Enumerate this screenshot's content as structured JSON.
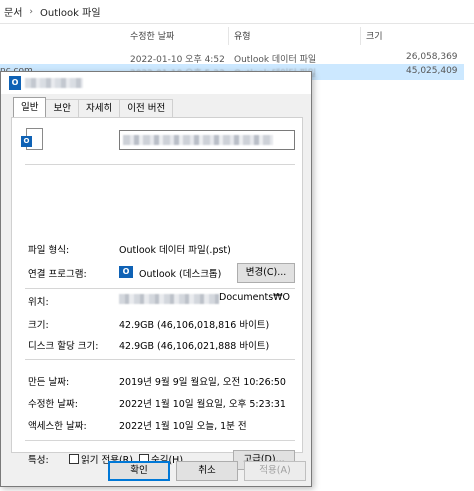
{
  "explorer": {
    "breadcrumb": [
      "문서",
      "Outlook 파일"
    ],
    "breadcrumb_sep": "›",
    "columns": {
      "modified": "수정한 날짜",
      "type": "유형",
      "size": "크기"
    },
    "rows": [
      {
        "name_fragment": "",
        "modified": "2022-01-10 오후 4:52",
        "type": "Outlook 데이터 파일",
        "size": "26,058,369"
      },
      {
        "name_fragment": "nc.com",
        "modified": "2022-01-10 오후 5:23",
        "type": "Outlook 데이터 파일",
        "size": "45,025,409"
      }
    ]
  },
  "dialog": {
    "title_icon": "outlook-icon",
    "tabs": [
      "일반",
      "보안",
      "자세히",
      "이전 버전"
    ],
    "active_tab": "일반",
    "file_type_label": "파일 형식:",
    "file_type_value": "Outlook 데이터 파일(.pst)",
    "opens_with_label": "연결 프로그램:",
    "opens_with_value": "Outlook (데스크톱)",
    "change_button": "변경(C)...",
    "location_label": "위치:",
    "location_value_visible": "Documents₩O",
    "size_label": "크기:",
    "size_value": "42.9GB (46,106,018,816 바이트)",
    "size_on_disk_label": "디스크 할당 크기:",
    "size_on_disk_value": "42.9GB (46,106,021,888 바이트)",
    "created_label": "만든 날짜:",
    "created_value": "2019년 9월 9일 월요일, 오전 10:26:50",
    "modified_label": "수정한 날짜:",
    "modified_value": "2022년 1월 10일 월요일, 오후 5:23:31",
    "accessed_label": "액세스한 날짜:",
    "accessed_value": "2022년 1월 10일 오늘, 1분 전",
    "attributes_label": "특성:",
    "readonly_label": "읽기 전용(R)",
    "hidden_label": "숨김(H)",
    "advanced_button": "고급(D)...",
    "ok_button": "확인",
    "cancel_button": "취소",
    "apply_button": "적용(A)",
    "accent_color": "#0f62b5"
  }
}
